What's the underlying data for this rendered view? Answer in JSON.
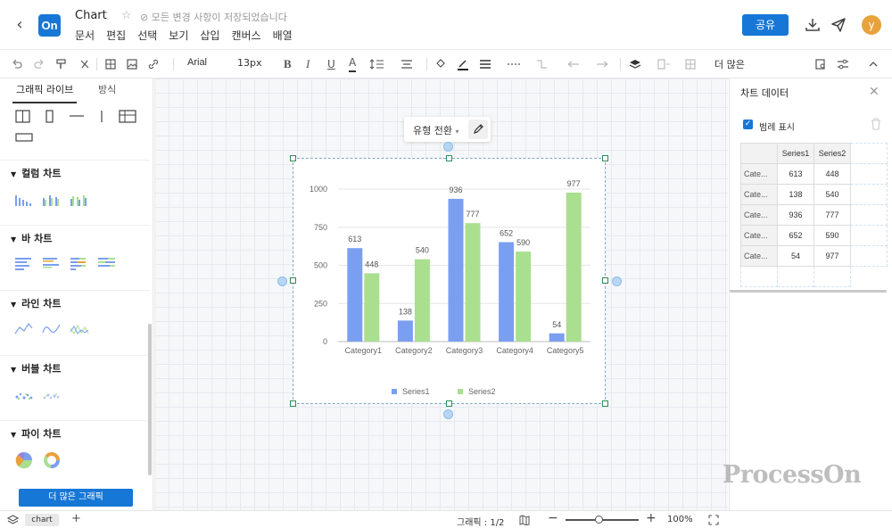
{
  "header": {
    "title": "Chart",
    "save_status": "⊘ 모든 변경 사항이 저장되었습니다",
    "logo_text": "On",
    "menus": [
      "문서",
      "편집",
      "선택",
      "보기",
      "삽입",
      "캔버스",
      "배열"
    ],
    "share_label": "공유",
    "avatar_letter": "y"
  },
  "toolbar": {
    "font": "Arial",
    "font_size": "13px",
    "more_label": "더 많은"
  },
  "sidebar": {
    "tabs": [
      "그래픽 라이브",
      "방식"
    ],
    "categories": [
      {
        "label": "컬럼 차트"
      },
      {
        "label": "바 차트"
      },
      {
        "label": "라인 차트"
      },
      {
        "label": "버블 차트"
      },
      {
        "label": "파이 차트"
      }
    ],
    "more_button": "더 많은 그래픽"
  },
  "canvas": {
    "popup_label": "유형 전환"
  },
  "chart_data": {
    "type": "bar",
    "categories": [
      "Category1",
      "Category2",
      "Category3",
      "Category4",
      "Category5"
    ],
    "series": [
      {
        "name": "Series1",
        "values": [
          613,
          138,
          936,
          652,
          54
        ],
        "color": "#7b9ff0"
      },
      {
        "name": "Series2",
        "values": [
          448,
          540,
          777,
          590,
          977
        ],
        "color": "#a9df8f"
      }
    ],
    "yticks": [
      "0",
      "250",
      "500",
      "750",
      "1000"
    ],
    "ylim": [
      0,
      1000
    ],
    "legend": "bottom",
    "grid": true
  },
  "right_panel": {
    "title": "차트 데이터",
    "legend_checkbox_label": "범례 표시",
    "legend_checked": true,
    "table": {
      "headers": [
        "",
        "Series1",
        "Series2"
      ],
      "rows": [
        [
          "Cate...",
          "613",
          "448"
        ],
        [
          "Cate...",
          "138",
          "540"
        ],
        [
          "Cate...",
          "936",
          "777"
        ],
        [
          "Cate...",
          "652",
          "590"
        ],
        [
          "Cate...",
          "54",
          "977"
        ]
      ]
    }
  },
  "bottombar": {
    "page_tab": "chart",
    "page_count": "그래픽 : 1/2",
    "zoom_level": "100%",
    "zoom_fraction": 0.5
  },
  "watermark": "ProcessOn"
}
